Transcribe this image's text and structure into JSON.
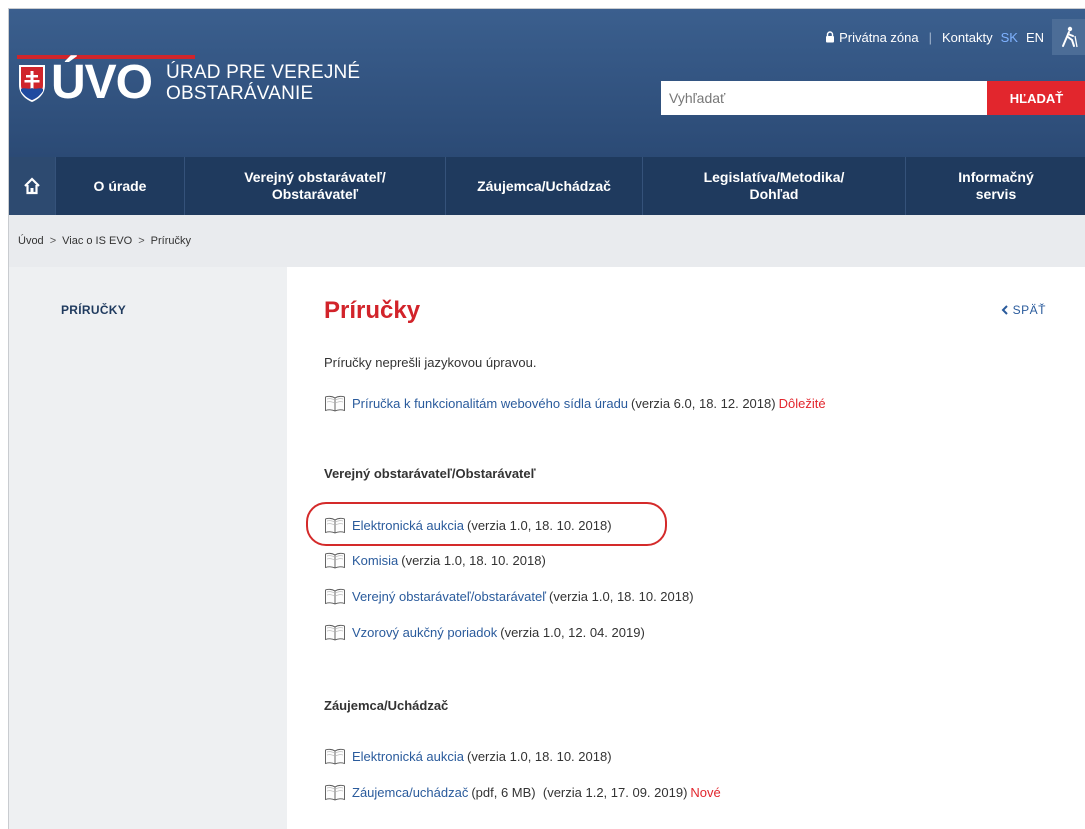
{
  "header": {
    "logo_text": "ÚVO",
    "org_line1": "ÚRAD PRE VEREJNÉ",
    "org_line2": "OBSTARÁVANIE",
    "private_zone": "Privátna zóna",
    "separator": "|",
    "contacts": "Kontakty",
    "lang_sk": "SK",
    "lang_en": "EN",
    "search_placeholder": "Vyhľadať",
    "search_button": "HĽADAŤ"
  },
  "nav": {
    "items": [
      {
        "label1": "O úrade",
        "label2": ""
      },
      {
        "label1": "Verejný obstarávateľ/",
        "label2": "Obstarávateľ"
      },
      {
        "label1": "Záujemca/Uchádzač",
        "label2": ""
      },
      {
        "label1": "Legislatíva/Metodika/",
        "label2": "Dohľad"
      },
      {
        "label1": "Informačný",
        "label2": "servis"
      }
    ]
  },
  "breadcrumb": {
    "items": [
      "Úvod",
      "Viac o IS EVO",
      "Príručky"
    ],
    "sep": ">"
  },
  "sidebar": {
    "title": "PRÍRUČKY"
  },
  "main": {
    "title": "Príručky",
    "back": "SPÄŤ",
    "intro": "Príručky neprešli jazykovou úpravou.",
    "general": {
      "link": "Príručka k funkcionalitám webového sídla úradu",
      "meta": "(verzia 6.0, 18. 12. 2018)",
      "badge": "Dôležité"
    },
    "section1": {
      "title": "Verejný obstarávateľ/Obstarávateľ",
      "items": [
        {
          "link": "Elektronická aukcia",
          "meta": "(verzia 1.0, 18. 10. 2018)"
        },
        {
          "link": "Komisia",
          "meta": "(verzia 1.0, 18. 10. 2018)"
        },
        {
          "link": "Verejný obstarávateľ/obstarávateľ",
          "meta": "(verzia 1.0, 18. 10. 2018)"
        },
        {
          "link": "Vzorový aukčný poriadok",
          "meta": "(verzia 1.0, 12. 04. 2019)"
        }
      ]
    },
    "section2": {
      "title": "Záujemca/Uchádzač",
      "items": [
        {
          "link": "Elektronická aukcia",
          "meta": "(verzia 1.0, 18. 10. 2018)"
        },
        {
          "link": "Záujemca/uchádzač",
          "meta": "(pdf, 6 MB)  (verzia 1.2, 17. 09. 2019)",
          "badge": "Nové"
        }
      ]
    }
  },
  "colors": {
    "header_blue": "#2b4a75",
    "nav_dark": "#1f3a5e",
    "accent_red": "#e2262d",
    "link_blue": "#2a5b9c"
  }
}
